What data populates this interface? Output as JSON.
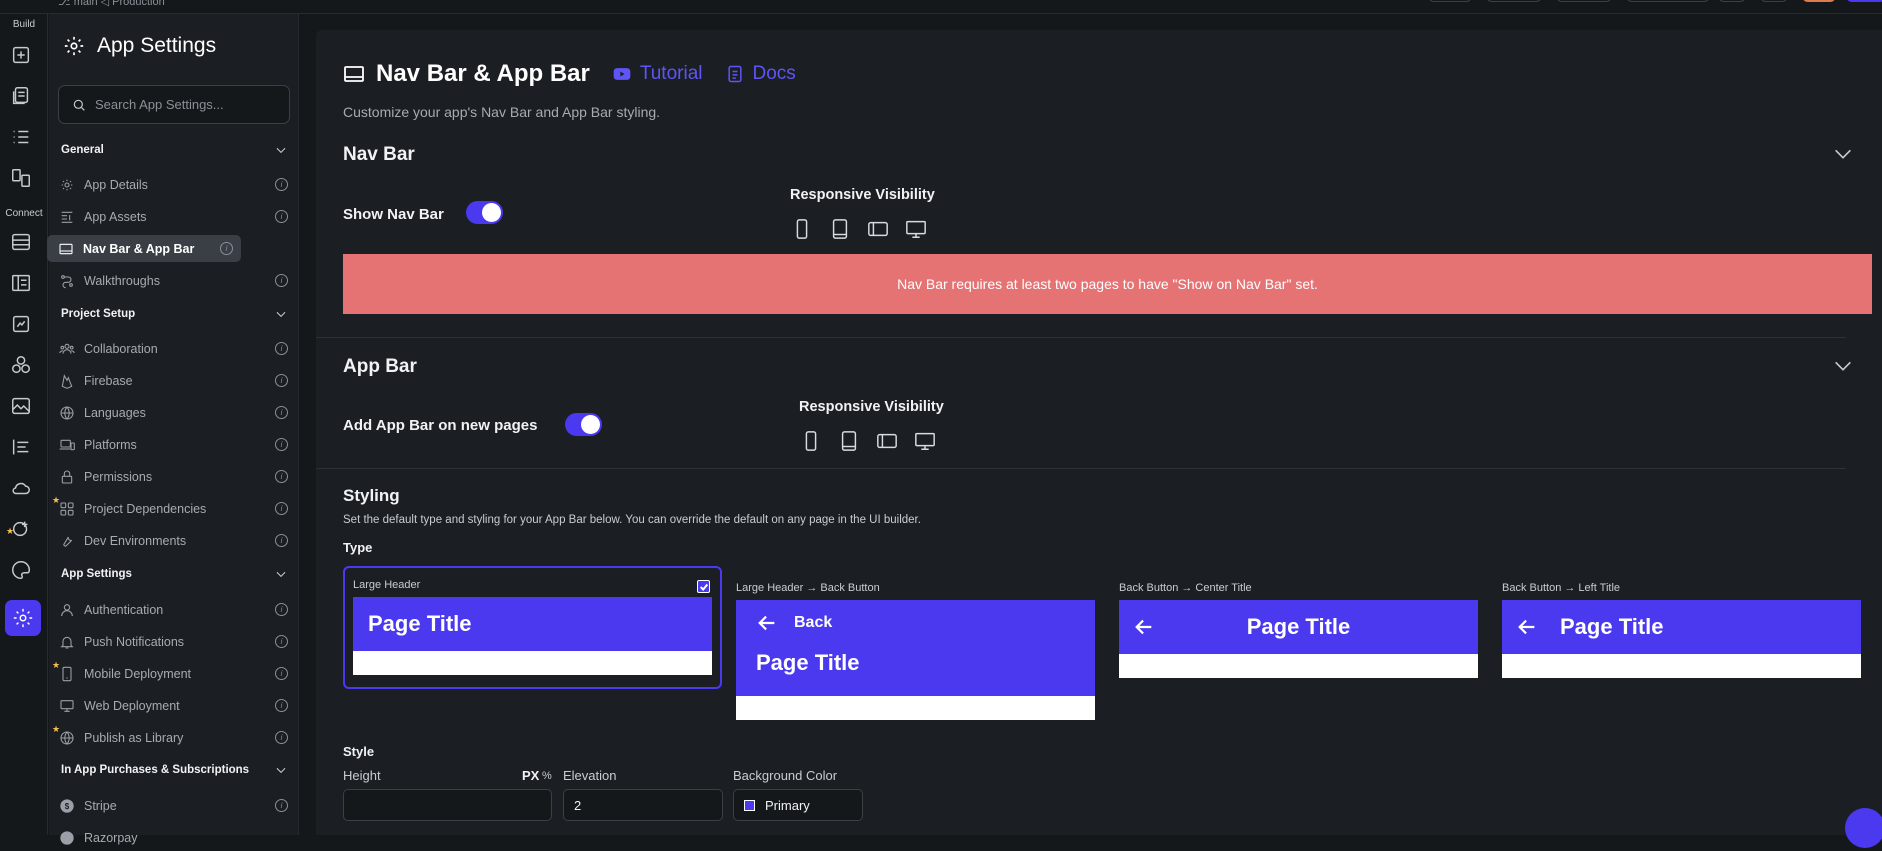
{
  "topbar": {
    "crumb": "⎇ main  ◁ Production"
  },
  "rail": {
    "build_label": "Build",
    "connect_label": "Connect",
    "icons": [
      "add-page-icon",
      "pages-icon",
      "list-icon",
      "components-icon",
      "database-icon",
      "schema-icon",
      "api-icon",
      "integrations-icon",
      "media-icon",
      "text-list-icon",
      "cloud-icon",
      "custom-code-icon",
      "theme-icon",
      "settings-icon"
    ]
  },
  "sidebar": {
    "title": "App Settings",
    "search_placeholder": "Search App Settings...",
    "groups": [
      {
        "label": "General"
      },
      {
        "label": "Project Setup"
      },
      {
        "label": "App Settings"
      },
      {
        "label": "In App Purchases & Subscriptions"
      }
    ],
    "items": [
      {
        "label": "App Details"
      },
      {
        "label": "App Assets"
      },
      {
        "label": "Nav Bar & App Bar"
      },
      {
        "label": "Walkthroughs"
      },
      {
        "label": "Collaboration"
      },
      {
        "label": "Firebase"
      },
      {
        "label": "Languages"
      },
      {
        "label": "Platforms"
      },
      {
        "label": "Permissions"
      },
      {
        "label": "Project Dependencies"
      },
      {
        "label": "Dev Environments"
      },
      {
        "label": "Authentication"
      },
      {
        "label": "Push Notifications"
      },
      {
        "label": "Mobile Deployment"
      },
      {
        "label": "Web Deployment"
      },
      {
        "label": "Publish as Library"
      },
      {
        "label": "Stripe"
      },
      {
        "label": "Razorpay"
      }
    ]
  },
  "main": {
    "title": "Nav Bar & App Bar",
    "tutorial_label": "Tutorial",
    "docs_label": "Docs",
    "subtitle": "Customize your app's Nav Bar and App Bar styling.",
    "nav_bar": {
      "heading": "Nav Bar",
      "show_label": "Show Nav Bar",
      "show_enabled": true,
      "responsive_label": "Responsive Visibility",
      "warning": "Nav Bar requires at least two pages to have \"Show on Nav Bar\" set."
    },
    "app_bar": {
      "heading": "App Bar",
      "add_label": "Add App Bar on new pages",
      "add_enabled": true,
      "responsive_label": "Responsive Visibility"
    },
    "styling": {
      "heading": "Styling",
      "description": "Set the default type and styling for your App Bar below. You can override the default on any page in the UI builder.",
      "type_label": "Type",
      "types": [
        {
          "caption": "Large Header",
          "title": "Page Title",
          "selected": true
        },
        {
          "caption": "Large Header → Back Button",
          "back": "Back",
          "title": "Page Title"
        },
        {
          "caption": "Back Button → Center Title",
          "title": "Page Title"
        },
        {
          "caption": "Back Button → Left Title",
          "title": "Page Title"
        }
      ],
      "style_label": "Style",
      "height_label": "Height",
      "units_label": "PX",
      "units_alt": "%",
      "height_value": "",
      "elevation_label": "Elevation",
      "elevation_value": "2",
      "bg_label": "Background Color",
      "bg_value": "Primary",
      "bg_color": "#4b39ef"
    }
  }
}
